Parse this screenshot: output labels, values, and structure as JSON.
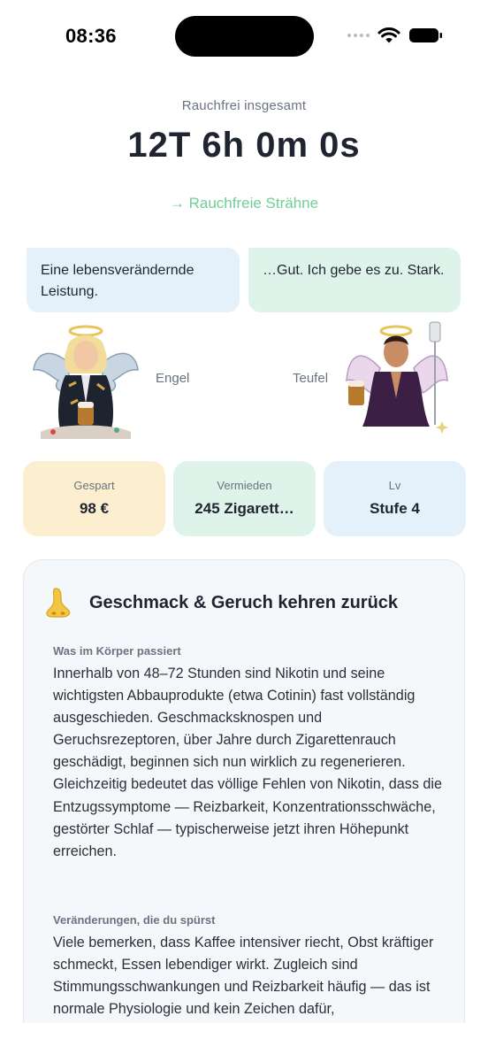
{
  "status_bar": {
    "time": "08:36"
  },
  "header": {
    "total_label": "Rauchfrei insgesamt",
    "total_value": "12T 6h 0m 0s",
    "streak_link": "→ Rauchfreie Strähne"
  },
  "companions": {
    "angel": {
      "message": "Eine lebensverändernde Leistung.",
      "name": "Engel"
    },
    "devil": {
      "message": "…Gut. Ich gebe es zu. Stark.",
      "name": "Teufel"
    }
  },
  "stats": [
    {
      "label": "Gespart",
      "value": "98 €"
    },
    {
      "label": "Vermieden",
      "value": "245 Zigarett…"
    },
    {
      "label": "Lv",
      "value": "Stufe 4"
    }
  ],
  "milestone": {
    "icon": "nose-icon",
    "title": "Geschmack & Geruch kehren zurück",
    "body_label": "Was im Körper passiert",
    "body_text": "Innerhalb von 48–72 Stunden sind Nikotin und seine wichtigsten Abbauprodukte (etwa Cotinin) fast vollständig ausgeschieden. Geschmacksknospen und Geruchsrezeptoren, über Jahre durch Zigarettenrauch geschädigt, beginnen sich nun wirklich zu regenerieren. Gleichzeitig bedeutet das völlige Fehlen von Nikotin, dass die Entzugssymptome — Reizbarkeit, Konzentrationsschwäche, gestörter Schlaf — typischerweise jetzt ihren Höhepunkt erreichen.",
    "changes_label": "Veränderungen, die du spürst",
    "changes_text": "Viele bemerken, dass Kaffee intensiver riecht, Obst kräftiger schmeckt, Essen lebendiger wirkt. Zugleich sind Stimmungsschwankungen und Reizbarkeit häufig — das ist normale Physiologie und kein Zeichen dafür,"
  },
  "colors": {
    "accent_green": "#6fcf97",
    "angel_bubble": "#e4f1fb",
    "devil_bubble": "#def4ea",
    "saved_bg": "#fbefcf"
  }
}
